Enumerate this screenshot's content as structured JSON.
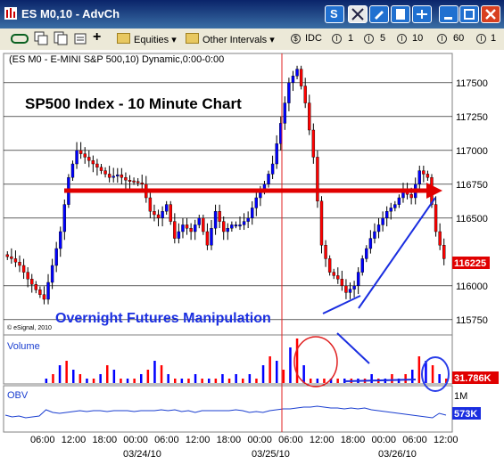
{
  "window": {
    "title": "ES M0,10 - AdvCh"
  },
  "toolbar": {
    "equities": "Equities",
    "other_intervals": "Other Intervals",
    "symbol": "IDC",
    "intervals": [
      "1",
      "5",
      "10",
      "60",
      "1"
    ]
  },
  "chart_data": {
    "type": "candlestick",
    "symbol_header": "(ES M0 - E-MINI S&P 500,10) Dynamic,0:00-0:00",
    "title": "SP500 Index - 10 Minute Chart",
    "annotation": "Overnight Futures Manipulation",
    "copyright": "© eSignal, 2010",
    "y_ticks": [
      "117500",
      "117250",
      "117000",
      "116750",
      "116500",
      "116225",
      "116000",
      "115750"
    ],
    "y_tick_values": [
      117500,
      117250,
      117000,
      116750,
      116500,
      116250,
      116000,
      115750
    ],
    "ylim": [
      115650,
      117650
    ],
    "last_price": "116225",
    "price_path": [
      [
        0,
        116230
      ],
      [
        2,
        116200
      ],
      [
        4,
        116150
      ],
      [
        6,
        116050
      ],
      [
        8,
        115970
      ],
      [
        10,
        115900
      ],
      [
        12,
        116150
      ],
      [
        14,
        116400
      ],
      [
        16,
        116800
      ],
      [
        18,
        117000
      ],
      [
        20,
        116950
      ],
      [
        22,
        116900
      ],
      [
        24,
        116850
      ],
      [
        26,
        116800
      ],
      [
        28,
        116820
      ],
      [
        30,
        116780
      ],
      [
        32,
        116770
      ],
      [
        34,
        116750
      ],
      [
        36,
        116550
      ],
      [
        38,
        116500
      ],
      [
        40,
        116600
      ],
      [
        42,
        116350
      ],
      [
        44,
        116450
      ],
      [
        46,
        116400
      ],
      [
        48,
        116500
      ],
      [
        50,
        116300
      ],
      [
        52,
        116550
      ],
      [
        54,
        116400
      ],
      [
        56,
        116450
      ],
      [
        58,
        116450
      ],
      [
        60,
        116500
      ],
      [
        62,
        116650
      ],
      [
        64,
        116750
      ],
      [
        66,
        116900
      ],
      [
        68,
        117200
      ],
      [
        70,
        117500
      ],
      [
        72,
        117600
      ],
      [
        74,
        117350
      ],
      [
        76,
        116950
      ],
      [
        78,
        116300
      ],
      [
        80,
        116100
      ],
      [
        82,
        116050
      ],
      [
        84,
        115950
      ],
      [
        86,
        116000
      ],
      [
        88,
        116200
      ],
      [
        90,
        116350
      ],
      [
        92,
        116450
      ],
      [
        94,
        116550
      ],
      [
        96,
        116600
      ],
      [
        98,
        116700
      ],
      [
        100,
        116650
      ],
      [
        102,
        116850
      ],
      [
        104,
        116800
      ],
      [
        106,
        116400
      ],
      [
        108,
        116200
      ]
    ],
    "volume": {
      "label": "Volume",
      "last": "31.786K",
      "bars": [
        0,
        0,
        0,
        0,
        0,
        0,
        1,
        2,
        4,
        5,
        3,
        2,
        1,
        1,
        2,
        4,
        3,
        1,
        1,
        1,
        2,
        3,
        5,
        4,
        2,
        1,
        1,
        1,
        2,
        1,
        1,
        1,
        2,
        1,
        2,
        1,
        2,
        1,
        4,
        6,
        5,
        3,
        8,
        10,
        4,
        1,
        1,
        1,
        1,
        1,
        1,
        1,
        1,
        1,
        2,
        1,
        1,
        2,
        1,
        2,
        3,
        6,
        5,
        4,
        2,
        1
      ]
    },
    "obv": {
      "label": "OBV",
      "tick": "1M",
      "last": "573K"
    },
    "x_tick_labels": [
      "06:00",
      "12:00",
      "18:00",
      "00:00",
      "06:00",
      "12:00",
      "18:00",
      "00:00",
      "06:00",
      "12:00",
      "18:00",
      "00:00",
      "06:00",
      "12:00"
    ],
    "date_labels": [
      "03/24/10",
      "03/25/10",
      "03/26/10"
    ],
    "colors": {
      "support_line": "#e00000",
      "annotation": "#1a2ee0",
      "up": "#0000ff",
      "down": "#ff0000"
    }
  }
}
